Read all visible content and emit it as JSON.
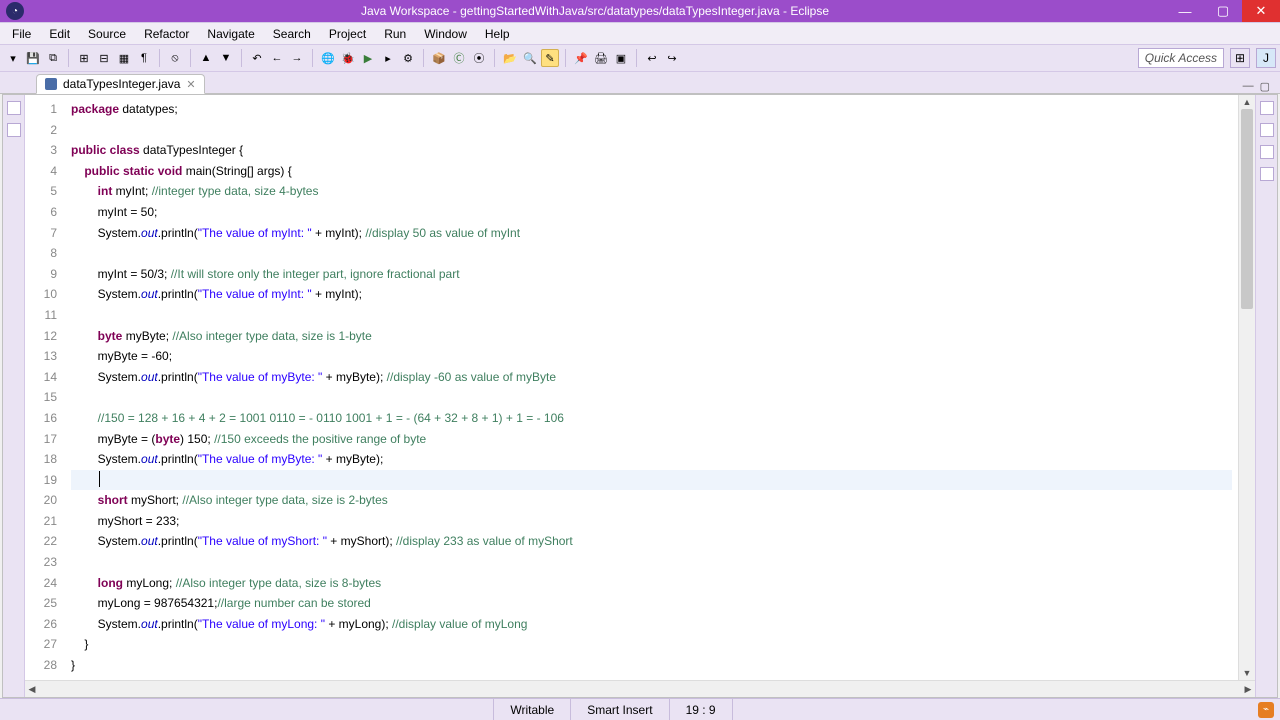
{
  "window": {
    "title": "Java Workspace - gettingStartedWithJava/src/datatypes/dataTypesInteger.java - Eclipse"
  },
  "menu": [
    "File",
    "Edit",
    "Source",
    "Refactor",
    "Navigate",
    "Search",
    "Project",
    "Run",
    "Window",
    "Help"
  ],
  "quick_access": "Quick Access",
  "tab": {
    "label": "dataTypesInteger.java"
  },
  "status": {
    "writable": "Writable",
    "insert_mode": "Smart Insert",
    "cursor": "19 : 9"
  },
  "code": {
    "lines": [
      [
        {
          "t": "k",
          "v": "package"
        },
        {
          "t": "n",
          "v": " datatypes;"
        }
      ],
      [
        {
          "t": "n",
          "v": ""
        }
      ],
      [
        {
          "t": "k",
          "v": "public class"
        },
        {
          "t": "n",
          "v": " dataTypesInteger {"
        }
      ],
      [
        {
          "t": "n",
          "v": "    "
        },
        {
          "t": "k",
          "v": "public static void"
        },
        {
          "t": "n",
          "v": " main(String[] args) {"
        }
      ],
      [
        {
          "t": "n",
          "v": "        "
        },
        {
          "t": "k",
          "v": "int"
        },
        {
          "t": "n",
          "v": " myInt; "
        },
        {
          "t": "c",
          "v": "//integer type data, size 4-bytes"
        }
      ],
      [
        {
          "t": "n",
          "v": "        myInt = 50;"
        }
      ],
      [
        {
          "t": "n",
          "v": "        System."
        },
        {
          "t": "f",
          "v": "out"
        },
        {
          "t": "n",
          "v": ".println("
        },
        {
          "t": "s",
          "v": "\"The value of myInt: \""
        },
        {
          "t": "n",
          "v": " + myInt); "
        },
        {
          "t": "c",
          "v": "//display 50 as value of myInt"
        }
      ],
      [
        {
          "t": "n",
          "v": ""
        }
      ],
      [
        {
          "t": "n",
          "v": "        myInt = 50/3; "
        },
        {
          "t": "c",
          "v": "//It will store only the integer part, ignore fractional part"
        }
      ],
      [
        {
          "t": "n",
          "v": "        System."
        },
        {
          "t": "f",
          "v": "out"
        },
        {
          "t": "n",
          "v": ".println("
        },
        {
          "t": "s",
          "v": "\"The value of myInt: \""
        },
        {
          "t": "n",
          "v": " + myInt);"
        }
      ],
      [
        {
          "t": "n",
          "v": ""
        }
      ],
      [
        {
          "t": "n",
          "v": "        "
        },
        {
          "t": "k",
          "v": "byte"
        },
        {
          "t": "n",
          "v": " myByte; "
        },
        {
          "t": "c",
          "v": "//Also integer type data, size is 1-byte"
        }
      ],
      [
        {
          "t": "n",
          "v": "        myByte = -60;"
        }
      ],
      [
        {
          "t": "n",
          "v": "        System."
        },
        {
          "t": "f",
          "v": "out"
        },
        {
          "t": "n",
          "v": ".println("
        },
        {
          "t": "s",
          "v": "\"The value of myByte: \""
        },
        {
          "t": "n",
          "v": " + myByte); "
        },
        {
          "t": "c",
          "v": "//display -60 as value of myByte"
        }
      ],
      [
        {
          "t": "n",
          "v": ""
        }
      ],
      [
        {
          "t": "n",
          "v": "        "
        },
        {
          "t": "c",
          "v": "//150 = 128 + 16 + 4 + 2 = 1001 0110 = - 0110 1001 + 1 = - (64 + 32 + 8 + 1) + 1 = - 106"
        }
      ],
      [
        {
          "t": "n",
          "v": "        myByte = ("
        },
        {
          "t": "k",
          "v": "byte"
        },
        {
          "t": "n",
          "v": ") 150; "
        },
        {
          "t": "c",
          "v": "//150 exceeds the positive range of byte"
        }
      ],
      [
        {
          "t": "n",
          "v": "        System."
        },
        {
          "t": "f",
          "v": "out"
        },
        {
          "t": "n",
          "v": ".println("
        },
        {
          "t": "s",
          "v": "\"The value of myByte: \""
        },
        {
          "t": "n",
          "v": " + myByte);"
        }
      ],
      [
        {
          "t": "n",
          "v": "        "
        }
      ],
      [
        {
          "t": "n",
          "v": "        "
        },
        {
          "t": "k",
          "v": "short"
        },
        {
          "t": "n",
          "v": " myShort; "
        },
        {
          "t": "c",
          "v": "//Also integer type data, size is 2-bytes"
        }
      ],
      [
        {
          "t": "n",
          "v": "        myShort = 233;"
        }
      ],
      [
        {
          "t": "n",
          "v": "        System."
        },
        {
          "t": "f",
          "v": "out"
        },
        {
          "t": "n",
          "v": ".println("
        },
        {
          "t": "s",
          "v": "\"The value of myShort: \""
        },
        {
          "t": "n",
          "v": " + myShort); "
        },
        {
          "t": "c",
          "v": "//display 233 as value of myShort"
        }
      ],
      [
        {
          "t": "n",
          "v": ""
        }
      ],
      [
        {
          "t": "n",
          "v": "        "
        },
        {
          "t": "k",
          "v": "long"
        },
        {
          "t": "n",
          "v": " myLong; "
        },
        {
          "t": "c",
          "v": "//Also integer type data, size is 8-bytes"
        }
      ],
      [
        {
          "t": "n",
          "v": "        myLong = 987654321;"
        },
        {
          "t": "c",
          "v": "//large number can be stored"
        }
      ],
      [
        {
          "t": "n",
          "v": "        System."
        },
        {
          "t": "f",
          "v": "out"
        },
        {
          "t": "n",
          "v": ".println("
        },
        {
          "t": "s",
          "v": "\"The value of myLong: \""
        },
        {
          "t": "n",
          "v": " + myLong); "
        },
        {
          "t": "c",
          "v": "//display value of myLong"
        }
      ],
      [
        {
          "t": "n",
          "v": "    }"
        }
      ],
      [
        {
          "t": "n",
          "v": "}"
        }
      ]
    ],
    "current_line": 19
  }
}
